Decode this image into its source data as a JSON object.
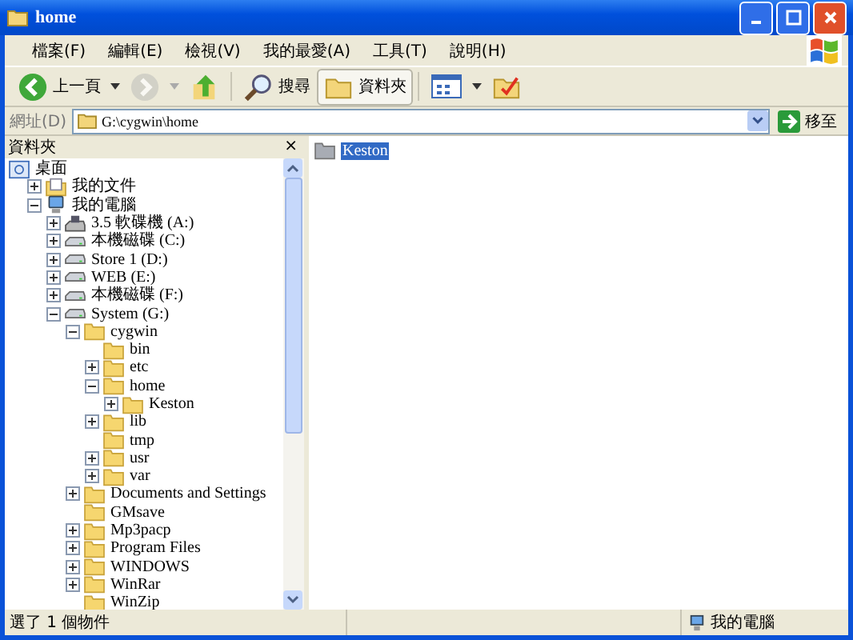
{
  "window": {
    "title": "home"
  },
  "menu": [
    "檔案(F)",
    "編輯(E)",
    "檢視(V)",
    "我的最愛(A)",
    "工具(T)",
    "說明(H)"
  ],
  "toolbar": {
    "back": {
      "label": "上一頁"
    },
    "forward": {
      "disabled": true
    },
    "search": {
      "label": "搜尋"
    },
    "folders": {
      "label": "資料夾",
      "selected": true
    }
  },
  "address": {
    "label": "網址(D)",
    "value": "G:\\cygwin\\home",
    "go": "移至"
  },
  "folders_pane": {
    "title": "資料夾",
    "close": "×"
  },
  "tree": [
    {
      "label": "桌面",
      "kind": "desktop",
      "children": [
        {
          "label": "我的文件",
          "kind": "documents",
          "expanded": false
        },
        {
          "label": "我的電腦",
          "kind": "computer",
          "expanded": true,
          "children": [
            {
              "label": "3.5 軟碟機 (A:)",
              "kind": "floppy",
              "expanded": false
            },
            {
              "label": "本機磁碟 (C:)",
              "kind": "drive",
              "expanded": false
            },
            {
              "label": "Store 1 (D:)",
              "kind": "drive",
              "expanded": false
            },
            {
              "label": "WEB (E:)",
              "kind": "drive",
              "expanded": false
            },
            {
              "label": "本機磁碟 (F:)",
              "kind": "drive",
              "expanded": false
            },
            {
              "label": "System (G:)",
              "kind": "drive",
              "expanded": true,
              "children": [
                {
                  "label": "cygwin",
                  "kind": "folder",
                  "expanded": true,
                  "children": [
                    {
                      "label": "bin",
                      "kind": "folder"
                    },
                    {
                      "label": "etc",
                      "kind": "folder",
                      "expanded": false
                    },
                    {
                      "label": "home",
                      "kind": "folder",
                      "expanded": true,
                      "children": [
                        {
                          "label": "Keston",
                          "kind": "folder",
                          "expanded": false
                        }
                      ]
                    },
                    {
                      "label": "lib",
                      "kind": "folder",
                      "expanded": false
                    },
                    {
                      "label": "tmp",
                      "kind": "folder"
                    },
                    {
                      "label": "usr",
                      "kind": "folder",
                      "expanded": false
                    },
                    {
                      "label": "var",
                      "kind": "folder",
                      "expanded": false
                    }
                  ]
                },
                {
                  "label": "Documents and Settings",
                  "kind": "folder",
                  "expanded": false
                },
                {
                  "label": "GMsave",
                  "kind": "folder"
                },
                {
                  "label": "Mp3pacp",
                  "kind": "folder",
                  "expanded": false
                },
                {
                  "label": "Program Files",
                  "kind": "folder",
                  "expanded": false
                },
                {
                  "label": "WINDOWS",
                  "kind": "folder",
                  "expanded": false
                },
                {
                  "label": "WinRar",
                  "kind": "folder",
                  "expanded": false
                },
                {
                  "label": "WinZip",
                  "kind": "folder"
                }
              ]
            }
          ]
        }
      ]
    }
  ],
  "files": [
    {
      "label": "Keston",
      "selected": true
    }
  ],
  "status_bar": {
    "message": "選了 1 個物件",
    "zone": "我的電腦"
  }
}
